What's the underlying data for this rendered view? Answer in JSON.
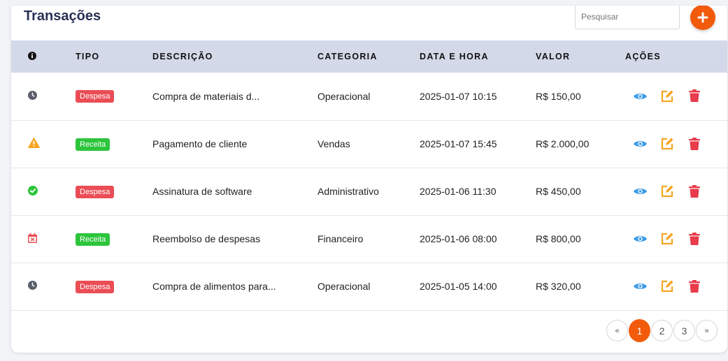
{
  "header": {
    "title": "Transações",
    "search_placeholder": "Pesquisar",
    "add_button_icon": "plus-icon"
  },
  "colors": {
    "accent": "#f25a0c",
    "despesa": "#ea4d55",
    "receita": "#2cc53b",
    "view": "#3c9be6",
    "edit": "#f5a623",
    "delete": "#e83b4b",
    "header_bg": "#d4d9e9",
    "title": "#2a3156"
  },
  "table": {
    "columns": {
      "status": "info-icon",
      "tipo": "TIPO",
      "descricao": "DESCRIÇÃO",
      "categoria": "CATEGORIA",
      "data_hora": "DATA E HORA",
      "valor": "VALOR",
      "acoes": "AÇÕES"
    },
    "rows": [
      {
        "status_icon": "clock-icon",
        "tipo": "Despesa",
        "descricao": "Compra de materiais d...",
        "categoria": "Operacional",
        "data_hora": "2025-01-07 10:15",
        "valor": "R$ 150,00"
      },
      {
        "status_icon": "warning-icon",
        "tipo": "Receita",
        "descricao": "Pagamento de cliente",
        "categoria": "Vendas",
        "data_hora": "2025-01-07 15:45",
        "valor": "R$ 2.000,00"
      },
      {
        "status_icon": "check-circle-icon",
        "tipo": "Despesa",
        "descricao": "Assinatura de software",
        "categoria": "Administrativo",
        "data_hora": "2025-01-06 11:30",
        "valor": "R$ 450,00"
      },
      {
        "status_icon": "calendar-x-icon",
        "tipo": "Receita",
        "descricao": "Reembolso de despesas",
        "categoria": "Financeiro",
        "data_hora": "2025-01-06 08:00",
        "valor": "R$ 800,00"
      },
      {
        "status_icon": "clock-icon",
        "tipo": "Despesa",
        "descricao": "Compra de alimentos para...",
        "categoria": "Operacional",
        "data_hora": "2025-01-05 14:00",
        "valor": "R$ 320,00"
      }
    ],
    "action_icons": [
      "eye-icon",
      "edit-icon",
      "trash-icon"
    ]
  },
  "pagination": {
    "prev": "«",
    "pages": [
      "1",
      "2",
      "3"
    ],
    "current": "1",
    "next": "»"
  }
}
